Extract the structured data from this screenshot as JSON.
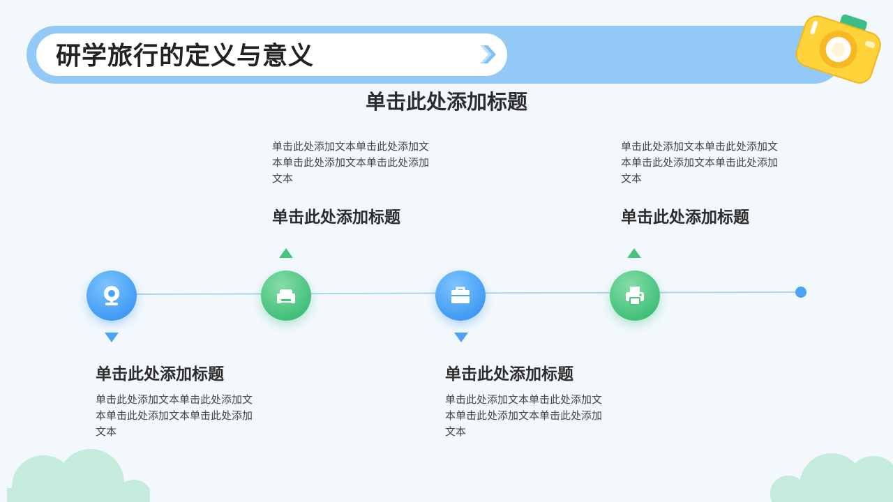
{
  "header": {
    "title": "研学旅行的定义与意义"
  },
  "main_title": "单击此处添加标题",
  "items": [
    {
      "title": "单击此处添加标题",
      "text": "单击此处添加文本单击此处添加文本单击此处添加文本单击此处添加文本",
      "icon": "webcam-icon",
      "color": "#4aa3f5"
    },
    {
      "title": "单击此处添加标题",
      "text": "单击此处添加文本单击此处添加文本单击此处添加文本单击此处添加文本",
      "icon": "sofa-icon",
      "color": "#46c57e"
    },
    {
      "title": "单击此处添加标题",
      "text": "单击此处添加文本单击此处添加文本单击此处添加文本单击此处添加文本",
      "icon": "toolbox-icon",
      "color": "#4aa3f5"
    },
    {
      "title": "单击此处添加标题",
      "text": "单击此处添加文本单击此处添加文本单击此处添加文本单击此处添加文本",
      "icon": "printer-icon",
      "color": "#46c57e"
    }
  ],
  "colors": {
    "background": "#f3f8fd",
    "header_band": "#93c9f7",
    "timeline": "#a8d6f0",
    "cloud": "#c5ebdc",
    "camera": "#ffd43b"
  }
}
